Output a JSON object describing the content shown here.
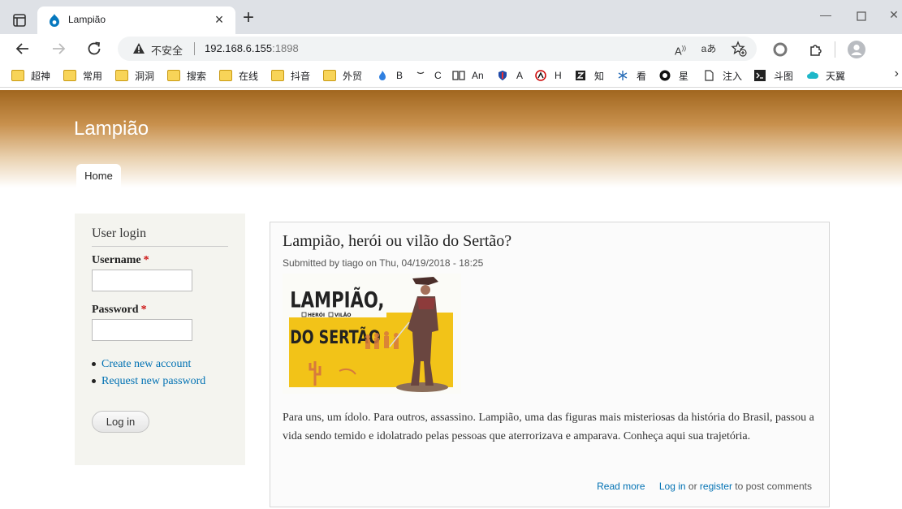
{
  "browser": {
    "tab_title": "Lampião",
    "security_label": "不安全",
    "url_host": "192.168.6.155",
    "url_port": ":1898",
    "read_aloud_label": "A",
    "translate_label": "aあ",
    "bookmarks": [
      {
        "label": "超神",
        "icon": "folder"
      },
      {
        "label": "常用",
        "icon": "folder"
      },
      {
        "label": "洞洞",
        "icon": "folder"
      },
      {
        "label": "搜索",
        "icon": "folder"
      },
      {
        "label": "在线",
        "icon": "folder"
      },
      {
        "label": "抖音",
        "icon": "folder"
      },
      {
        "label": "外贸",
        "icon": "folder"
      },
      {
        "label": "B",
        "icon": "flame"
      },
      {
        "label": "C",
        "icon": "page"
      },
      {
        "label": "An",
        "icon": "book"
      },
      {
        "label": "A",
        "icon": "shield"
      },
      {
        "label": "H",
        "icon": "hacker"
      },
      {
        "label": "知",
        "icon": "z"
      },
      {
        "label": "看",
        "icon": "snowflake"
      },
      {
        "label": "星",
        "icon": "github"
      },
      {
        "label": "注入",
        "icon": "doc"
      },
      {
        "label": "斗图",
        "icon": "terminal"
      },
      {
        "label": "天翼",
        "icon": "cloud"
      }
    ],
    "bookmarks_more": "›"
  },
  "site": {
    "name": "Lampião",
    "primary_tab": "Home"
  },
  "login": {
    "title": "User login",
    "username_label": "Username",
    "password_label": "Password",
    "required_mark": "*",
    "create_account": "Create new account",
    "request_password": "Request new password",
    "submit_label": "Log in"
  },
  "article": {
    "title": "Lampião, herói ou vilão do Sertão?",
    "submitted": "Submitted by tiago on Thu, 04/19/2018 - 18:25",
    "image": {
      "line1": "LAMPIÃO,",
      "opt1": "HERÓI",
      "opt2": "VILÃO",
      "line2": "DO SERTÃO"
    },
    "body": "Para uns, um ídolo. Para outros, assassino. Lampião, uma das figuras mais misteriosas da história do Brasil, passou a vida sendo temido e idolatrado pelas pessoas que aterrorizava e amparava. Conheça aqui sua trajetória.",
    "read_more": "Read more",
    "login_link": "Log in",
    "or_text": "or",
    "register_link": "register",
    "comment_suffix": "to post comments"
  },
  "colors": {
    "header_top": "#a1661f",
    "link": "#0071b3",
    "required": "#cc1111",
    "sidebar_bg": "#f4f4ef",
    "poster_yellow": "#f2c318"
  }
}
